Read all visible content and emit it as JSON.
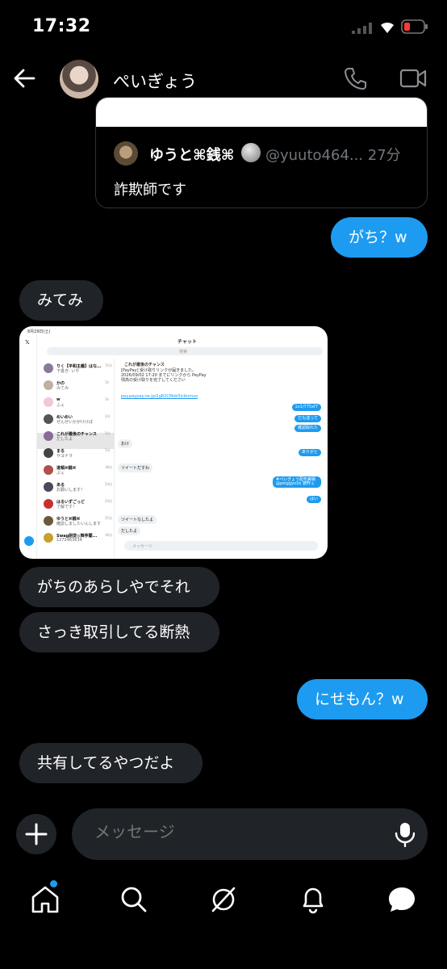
{
  "status_bar": {
    "time": "17:32"
  },
  "header": {
    "name": "ぺいぎょう"
  },
  "quoted": {
    "author": "ゆうと⌘銭⌘",
    "handle_time": "@yuuto464... 27分",
    "text": "詐欺師です"
  },
  "messages": [
    {
      "from": "me",
      "text": "がち？w"
    },
    {
      "from": "them",
      "text": "みてみ"
    },
    {
      "from": "them",
      "text": "がちのあらしやでそれ"
    },
    {
      "from": "them",
      "text": "さっき取引してる断熱"
    },
    {
      "from": "me",
      "text": "にせもん？w"
    },
    {
      "from": "them",
      "text": "共有してるやつだよ"
    }
  ],
  "screenshot": {
    "date": "8月29日(土)",
    "title": "チャット",
    "search": "検索",
    "chat_title": "これが最後のチャンス",
    "msg_text": "[PayPay] 受け取りリンクが届きました。2026/09/02 17:20 までにリンクから PayPay 残高の受け取りを完了してください",
    "link": "pay.paypay.ne.jp/2gR2CMob5lcbnmuo",
    "list": [
      {
        "name": "りく【平和主義】はな...",
        "sub": "下書き: いや",
        "time": "15分"
      },
      {
        "name": "かの",
        "sub": "みてみ",
        "time": "1h"
      },
      {
        "name": "w",
        "sub": "ふぇ",
        "time": "1h"
      },
      {
        "name": "めいめい",
        "sub": "ぜんぜいかがけけぼ",
        "time": "2分"
      },
      {
        "name": "これが最後のチャンス",
        "sub": "だしたよ",
        "time": "5分"
      },
      {
        "name": "まる",
        "sub": "サヨナラ",
        "time": "5分"
      },
      {
        "name": "道頓⌘銭⌘",
        "sub": "ぷぇ",
        "time": "18分"
      },
      {
        "name": "ある",
        "sub": "お願いします！",
        "time": "24分"
      },
      {
        "name": "はるいずごっど",
        "sub": "了解です！",
        "time": "24分"
      },
      {
        "name": "ゆうと⌘銭⌘",
        "sub": "確認しましたいんします",
        "time": "25分"
      },
      {
        "name": "Swag厨変◎舞亭闇...",
        "sub": "1272463634",
        "time": "30分"
      }
    ],
    "right_msgs": [
      "1x1/775xf7",
      "だも送って",
      "確認取れた",
      "ありがと",
      "#ぺいぎょう配布実績 @peiggyo1b 彼昨ぇ",
      "はい"
    ],
    "left_msgs": [
      "おけ",
      "ツイートだすわ",
      "ツイートなしたよ",
      "だしたよ"
    ],
    "input": "メッセージ"
  },
  "composer": {
    "placeholder": "メッセージ"
  }
}
